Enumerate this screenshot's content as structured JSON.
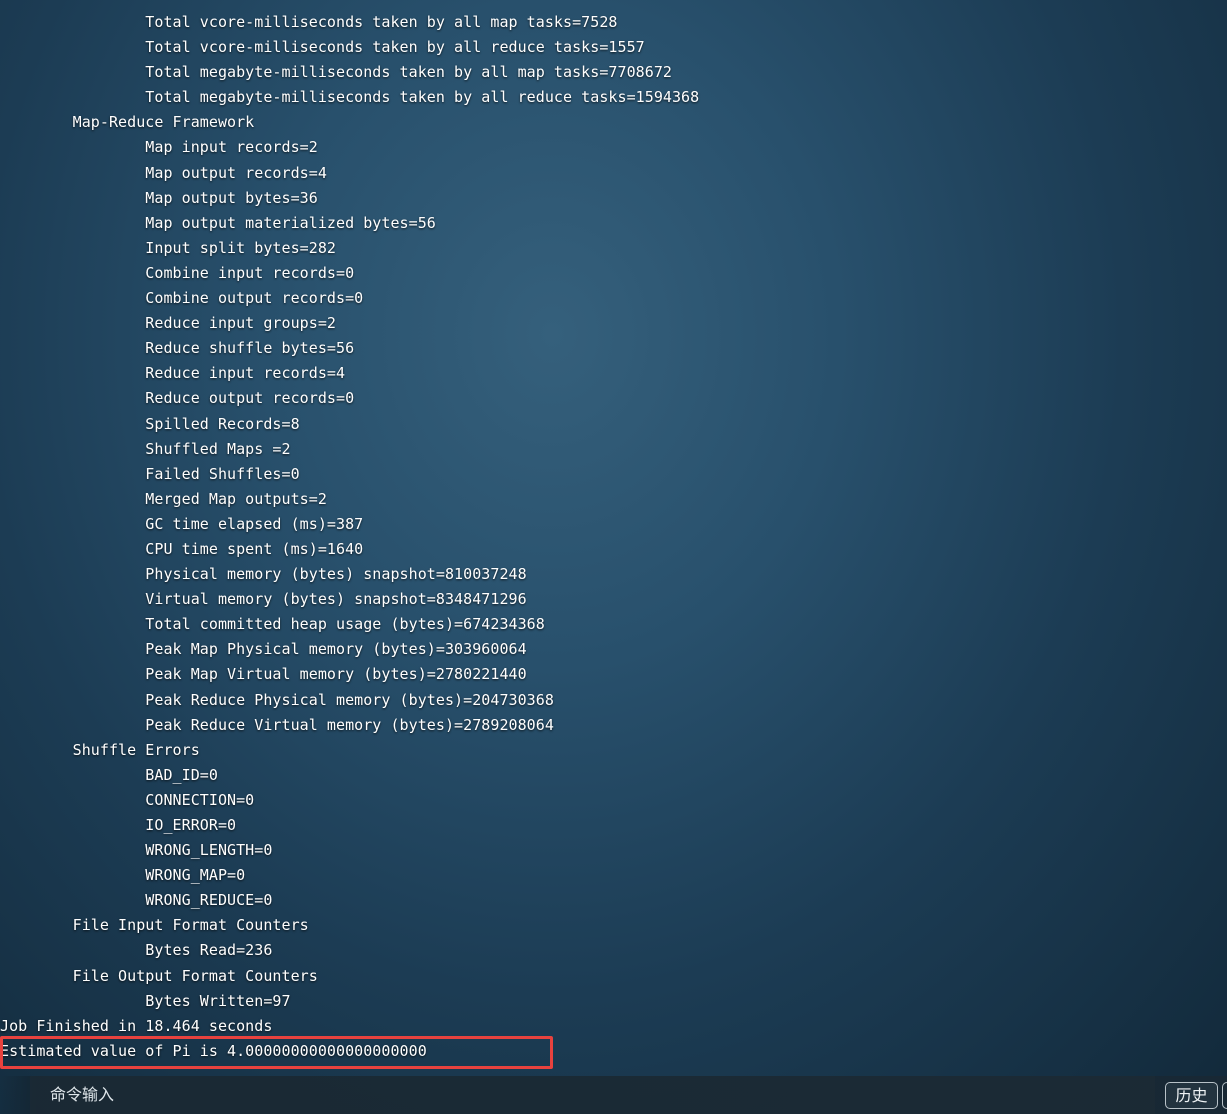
{
  "terminal": {
    "lines": [
      "                Total vcore-milliseconds taken by all map tasks=7528",
      "                Total vcore-milliseconds taken by all reduce tasks=1557",
      "                Total megabyte-milliseconds taken by all map tasks=7708672",
      "                Total megabyte-milliseconds taken by all reduce tasks=1594368",
      "        Map-Reduce Framework",
      "                Map input records=2",
      "                Map output records=4",
      "                Map output bytes=36",
      "                Map output materialized bytes=56",
      "                Input split bytes=282",
      "                Combine input records=0",
      "                Combine output records=0",
      "                Reduce input groups=2",
      "                Reduce shuffle bytes=56",
      "                Reduce input records=4",
      "                Reduce output records=0",
      "                Spilled Records=8",
      "                Shuffled Maps =2",
      "                Failed Shuffles=0",
      "                Merged Map outputs=2",
      "                GC time elapsed (ms)=387",
      "                CPU time spent (ms)=1640",
      "                Physical memory (bytes) snapshot=810037248",
      "                Virtual memory (bytes) snapshot=8348471296",
      "                Total committed heap usage (bytes)=674234368",
      "                Peak Map Physical memory (bytes)=303960064",
      "                Peak Map Virtual memory (bytes)=2780221440",
      "                Peak Reduce Physical memory (bytes)=204730368",
      "                Peak Reduce Virtual memory (bytes)=2789208064",
      "        Shuffle Errors",
      "                BAD_ID=0",
      "                CONNECTION=0",
      "                IO_ERROR=0",
      "                WRONG_LENGTH=0",
      "                WRONG_MAP=0",
      "                WRONG_REDUCE=0",
      "        File Input Format Counters",
      "                Bytes Read=236",
      "        File Output Format Counters",
      "                Bytes Written=97",
      "Job Finished in 18.464 seconds",
      "Estimated value of Pi is 4.00000000000000000000"
    ]
  },
  "command_bar": {
    "input_placeholder": "命令输入",
    "history_label": "历史"
  },
  "colors": {
    "highlight_border": "#e8423e",
    "terminal_text": "#ffffff",
    "background_center": "#35607c",
    "background_edge": "#12293a"
  }
}
